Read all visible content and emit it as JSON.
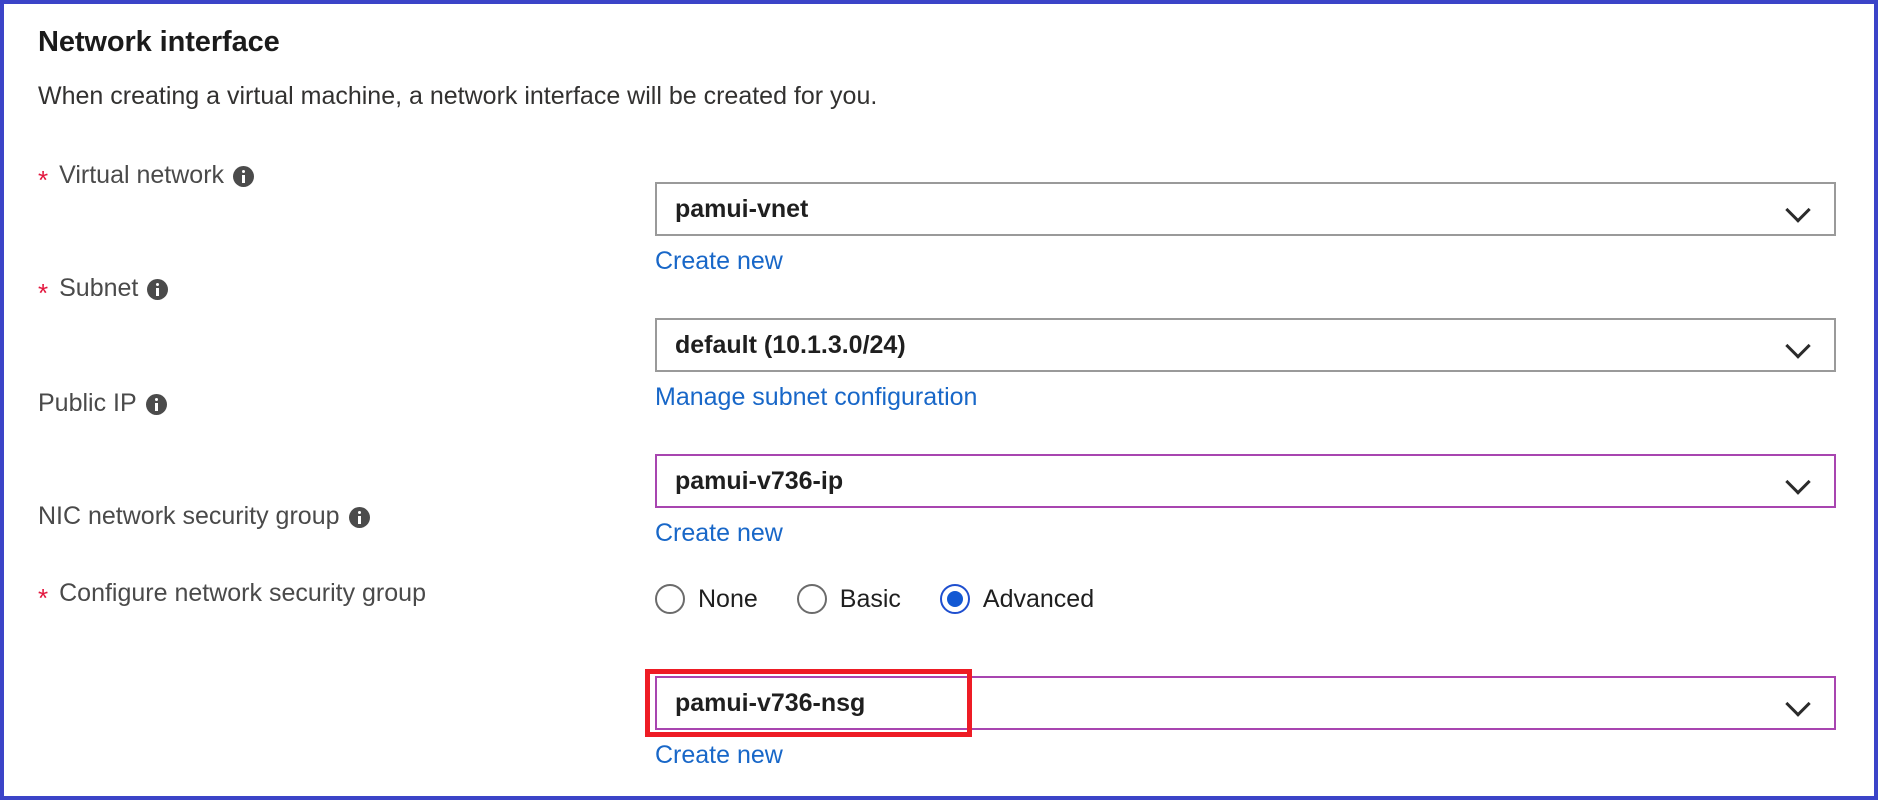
{
  "panel": {
    "title": "Network interface",
    "description": "When creating a virtual machine, a network interface will be created for you.",
    "border_color": "#3b44c8",
    "accent_border_color": "#a845b0",
    "highlight_color": "#ee1c25",
    "link_color": "#1867c8"
  },
  "fields": {
    "virtual_network": {
      "label": "Virtual network",
      "required_marker": "*",
      "info_icon": "info-icon",
      "value": "pamui-vnet",
      "chevron_icon": "chevron-down-icon",
      "sublink": "Create new"
    },
    "subnet": {
      "label": "Subnet",
      "required_marker": "*",
      "info_icon": "info-icon",
      "value": "default (10.1.3.0/24)",
      "chevron_icon": "chevron-down-icon",
      "sublink": "Manage subnet configuration"
    },
    "public_ip": {
      "label": "Public IP",
      "info_icon": "info-icon",
      "value": "pamui-v736-ip",
      "chevron_icon": "chevron-down-icon",
      "sublink": "Create new"
    },
    "nic_nsg": {
      "label": "NIC network security group",
      "info_icon": "info-icon",
      "options": [
        {
          "label": "None",
          "selected": false
        },
        {
          "label": "Basic",
          "selected": false
        },
        {
          "label": "Advanced",
          "selected": true
        }
      ]
    },
    "configure_nsg": {
      "label": "Configure network security group",
      "required_marker": "*",
      "value": "pamui-v736-nsg",
      "chevron_icon": "chevron-down-icon",
      "sublink": "Create new"
    }
  }
}
